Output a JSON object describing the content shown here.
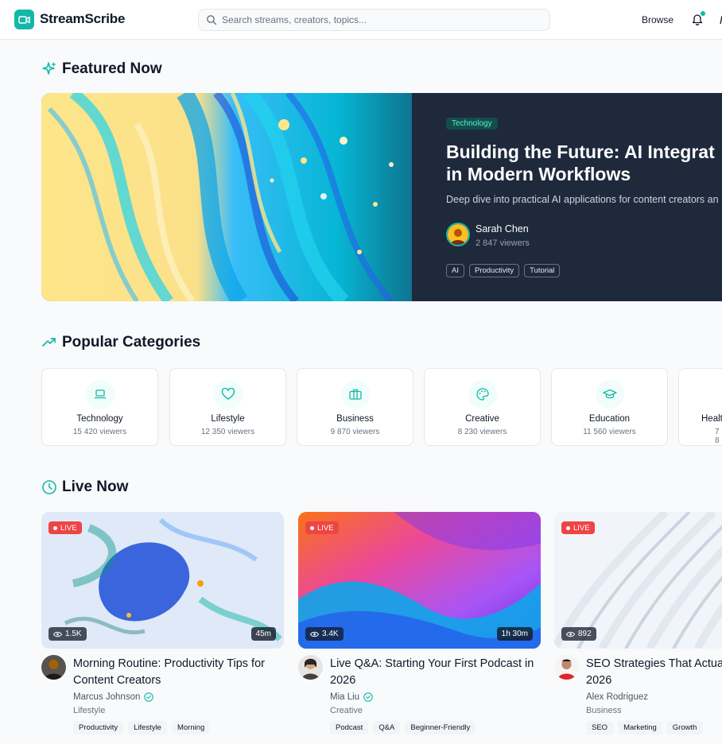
{
  "app": {
    "name": "StreamScribe"
  },
  "search": {
    "placeholder": "Search streams, creators, topics..."
  },
  "nav": {
    "browse": "Browse"
  },
  "featured_section": {
    "title": "Featured Now"
  },
  "featured": {
    "category": "Technology",
    "title_line1": "Building the Future: AI Integrat",
    "title_line2": "in Modern Workflows",
    "description": "Deep dive into practical AI applications for content creators an",
    "author": "Sarah Chen",
    "viewers": "2 847 viewers",
    "tags": [
      "AI",
      "Productivity",
      "Tutorial"
    ]
  },
  "categories_section": {
    "title": "Popular Categories"
  },
  "categories": [
    {
      "name": "Technology",
      "viewers": "15 420 viewers",
      "icon": "laptop-icon"
    },
    {
      "name": "Lifestyle",
      "viewers": "12 350 viewers",
      "icon": "heart-icon"
    },
    {
      "name": "Business",
      "viewers": "9 870 viewers",
      "icon": "briefcase-icon"
    },
    {
      "name": "Creative",
      "viewers": "8 230 viewers",
      "icon": "palette-icon"
    },
    {
      "name": "Education",
      "viewers": "11 560 viewers",
      "icon": "graduation-cap-icon"
    },
    {
      "name": "Healt",
      "viewers": "7 8",
      "icon": "heart-pulse-icon"
    }
  ],
  "live_section": {
    "title": "Live Now"
  },
  "live_streams": [
    {
      "badge": "LIVE",
      "views": "1.5K",
      "duration": "45m",
      "title": "Morning Routine: Productivity Tips for Content Creators",
      "creator": "Marcus Johnson",
      "verified": true,
      "category": "Lifestyle",
      "tags": [
        "Productivity",
        "Lifestyle",
        "Morning"
      ]
    },
    {
      "badge": "LIVE",
      "views": "3.4K",
      "duration": "1h 30m",
      "title": "Live Q&A: Starting Your First Podcast in 2026",
      "creator": "Mia Liu",
      "verified": true,
      "category": "Creative",
      "tags": [
        "Podcast",
        "Q&A",
        "Beginner-Friendly"
      ]
    },
    {
      "badge": "LIVE",
      "views": "892",
      "duration": "",
      "title": "SEO Strategies That Actual 2026",
      "creator": "Alex Rodriguez",
      "verified": false,
      "category": "Business",
      "tags": [
        "SEO",
        "Marketing",
        "Growth"
      ]
    }
  ],
  "colors": {
    "accent": "#14b8a6",
    "live": "#ef4444",
    "featured_bg": "#1e293b"
  }
}
